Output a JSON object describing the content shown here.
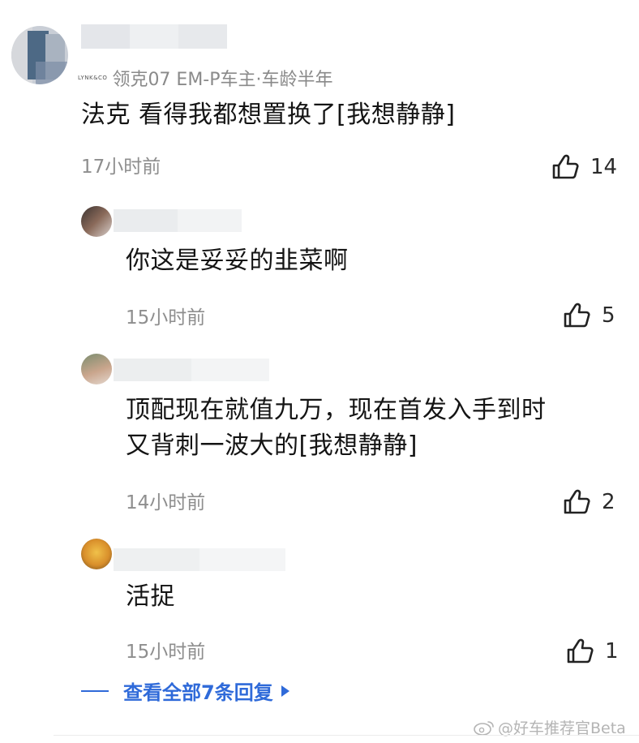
{
  "main_comment": {
    "badge_text": "LYNK&CO",
    "user_meta": "领克07 EM-P车主·车龄半年",
    "content": "法克 看得我都想置换了[我想静静]",
    "time": "17小时前",
    "likes": "14"
  },
  "replies": [
    {
      "content_lines": [
        "你这是妥妥的韭菜啊"
      ],
      "time": "15小时前",
      "likes": "5"
    },
    {
      "content_lines": [
        "顶配现在就值九万，现在首发入手到时",
        "又背刺一波大的[我想静静]"
      ],
      "time": "14小时前",
      "likes": "2"
    },
    {
      "content_lines": [
        "活捉"
      ],
      "time": "15小时前",
      "likes": "1"
    }
  ],
  "view_all_label": "查看全部7条回复",
  "watermark": "@好车推荐官Beta",
  "colors": {
    "link": "#2f6ad9",
    "meta": "#8a8a8a",
    "text": "#141414"
  },
  "icons": [
    "thumbs-up-icon",
    "triangle-right-icon",
    "weibo-icon"
  ]
}
